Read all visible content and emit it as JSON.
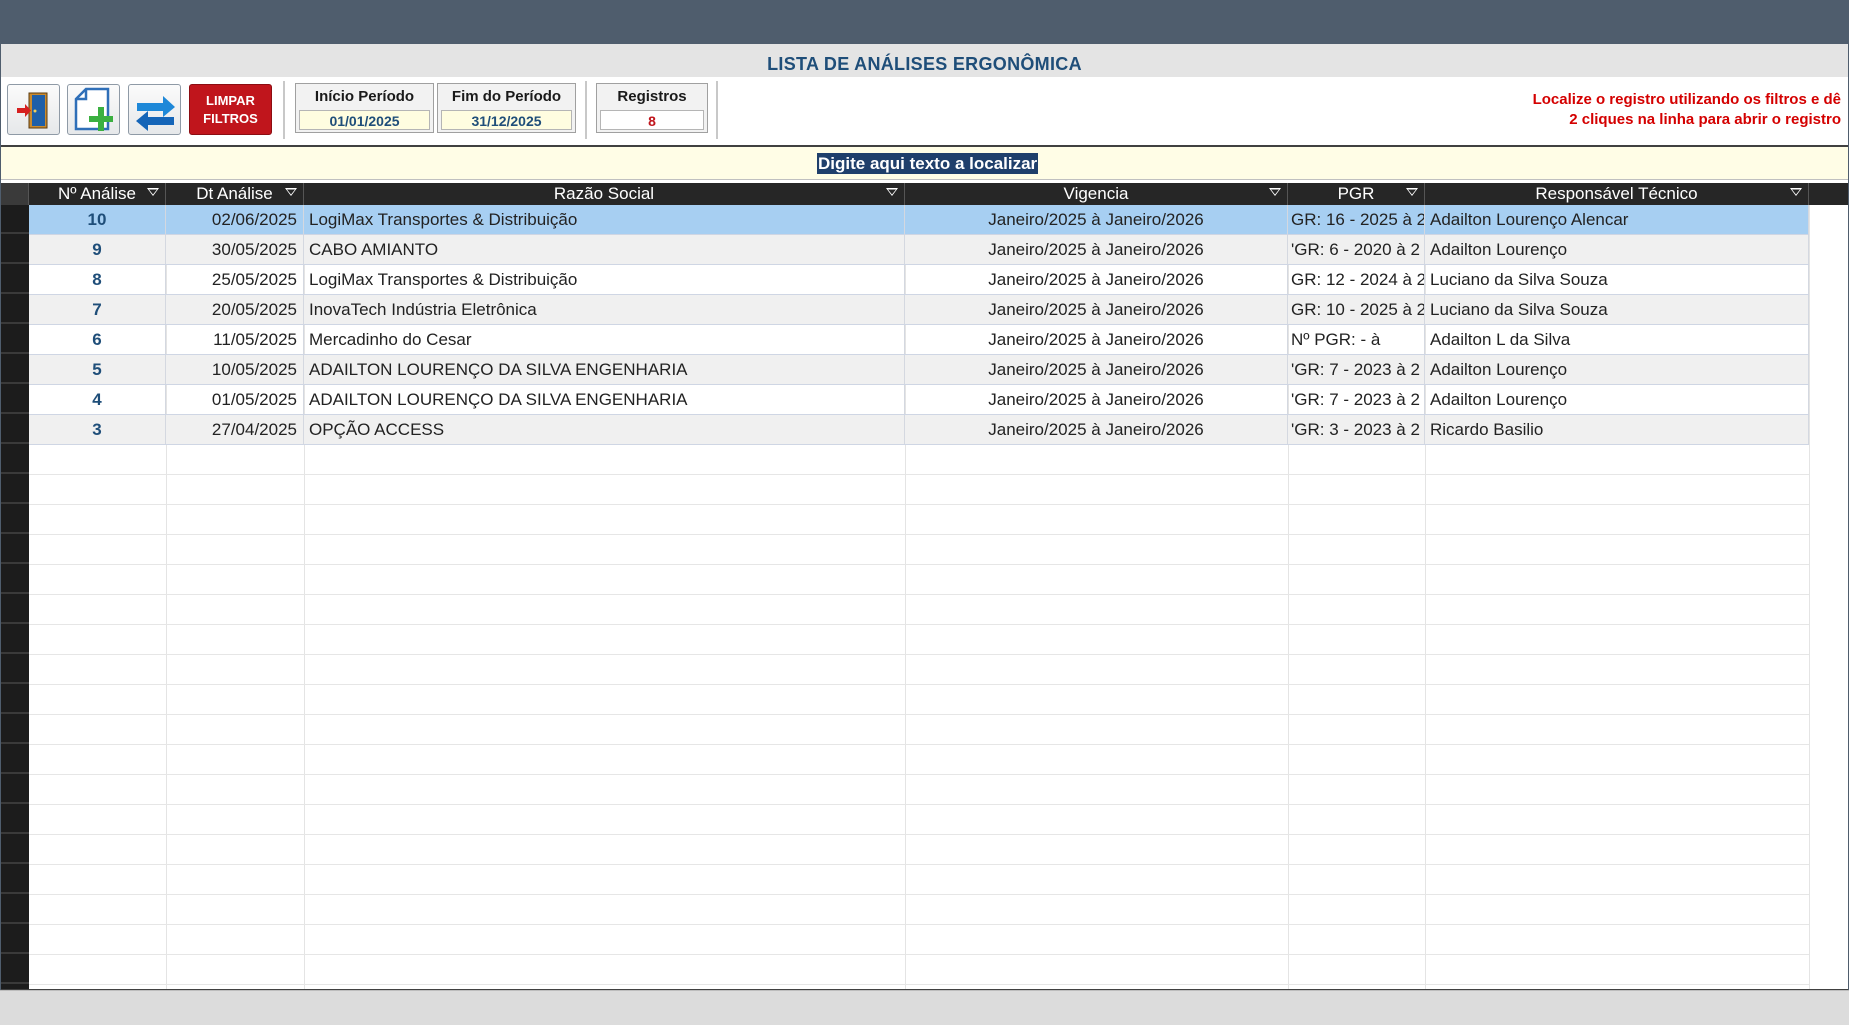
{
  "form": {
    "title": "LISTA DE  ANÁLISES ERGONÔMICA"
  },
  "toolbar": {
    "exit_icon": "door-exit-icon",
    "new_icon": "new-document-plus-icon",
    "refresh_icon": "refresh-arrows-icon",
    "clear_filters_label": "LIMPAR\nFILTROS",
    "start_label": "Início Período",
    "start_value": "01/01/2025",
    "end_label": "Fim do Período",
    "end_value": "31/12/2025",
    "records_label": "Registros",
    "records_value": "8",
    "hint_line1": "Localize o registro utilizando os filtros e dê",
    "hint_line2": "2 cliques na linha  para abrir o registro",
    "accent_color": "#c0151c"
  },
  "search": {
    "value": "Digite aqui texto a localizar"
  },
  "table": {
    "columns": [
      "Nº Análise",
      "Dt Análise",
      "Razão Social",
      "Vigencia",
      "PGR",
      "Responsável Técnico"
    ],
    "rows": [
      {
        "num": "10",
        "dt": "02/06/2025",
        "razao": "LogiMax Transportes & Distribuição",
        "vig": "Janeiro/2025 à Janeiro/2026",
        "pgr": "GR: 16 - 2025 à 2",
        "resp": "Adailton Lourenço Alencar"
      },
      {
        "num": "9",
        "dt": "30/05/2025",
        "razao": "CABO AMIANTO",
        "vig": "Janeiro/2025 à Janeiro/2026",
        "pgr": "'GR: 6 - 2020 à 2",
        "resp": "Adailton Lourenço"
      },
      {
        "num": "8",
        "dt": "25/05/2025",
        "razao": "LogiMax Transportes & Distribuição",
        "vig": "Janeiro/2025 à Janeiro/2026",
        "pgr": "GR: 12 - 2024 à 2",
        "resp": "Luciano da Silva Souza"
      },
      {
        "num": "7",
        "dt": "20/05/2025",
        "razao": "InovaTech Indústria Eletrônica",
        "vig": "Janeiro/2025 à Janeiro/2026",
        "pgr": "GR: 10 - 2025 à 2",
        "resp": "Luciano da Silva Souza"
      },
      {
        "num": "6",
        "dt": "11/05/2025",
        "razao": "Mercadinho do Cesar",
        "vig": "Janeiro/2025 à Janeiro/2026",
        "pgr": "  Nº PGR:  -  à",
        "resp": "Adailton L da Silva"
      },
      {
        "num": "5",
        "dt": "10/05/2025",
        "razao": "ADAILTON LOURENÇO DA SILVA ENGENHARIA",
        "vig": "Janeiro/2025 à Janeiro/2026",
        "pgr": "'GR: 7 - 2023 à 2",
        "resp": "Adailton Lourenço"
      },
      {
        "num": "4",
        "dt": "01/05/2025",
        "razao": "ADAILTON LOURENÇO DA SILVA ENGENHARIA",
        "vig": "Janeiro/2025 à Janeiro/2026",
        "pgr": "'GR: 7 - 2023 à 2",
        "resp": "Adailton Lourenço"
      },
      {
        "num": "3",
        "dt": "27/04/2025",
        "razao": "OPÇÃO ACCESS",
        "vig": "Janeiro/2025 à Janeiro/2026",
        "pgr": "'GR: 3 - 2023 à 2",
        "resp": "Ricardo Basilio"
      }
    ],
    "selected_row": 0,
    "filter_icon": "filter-dropdown-icon"
  }
}
